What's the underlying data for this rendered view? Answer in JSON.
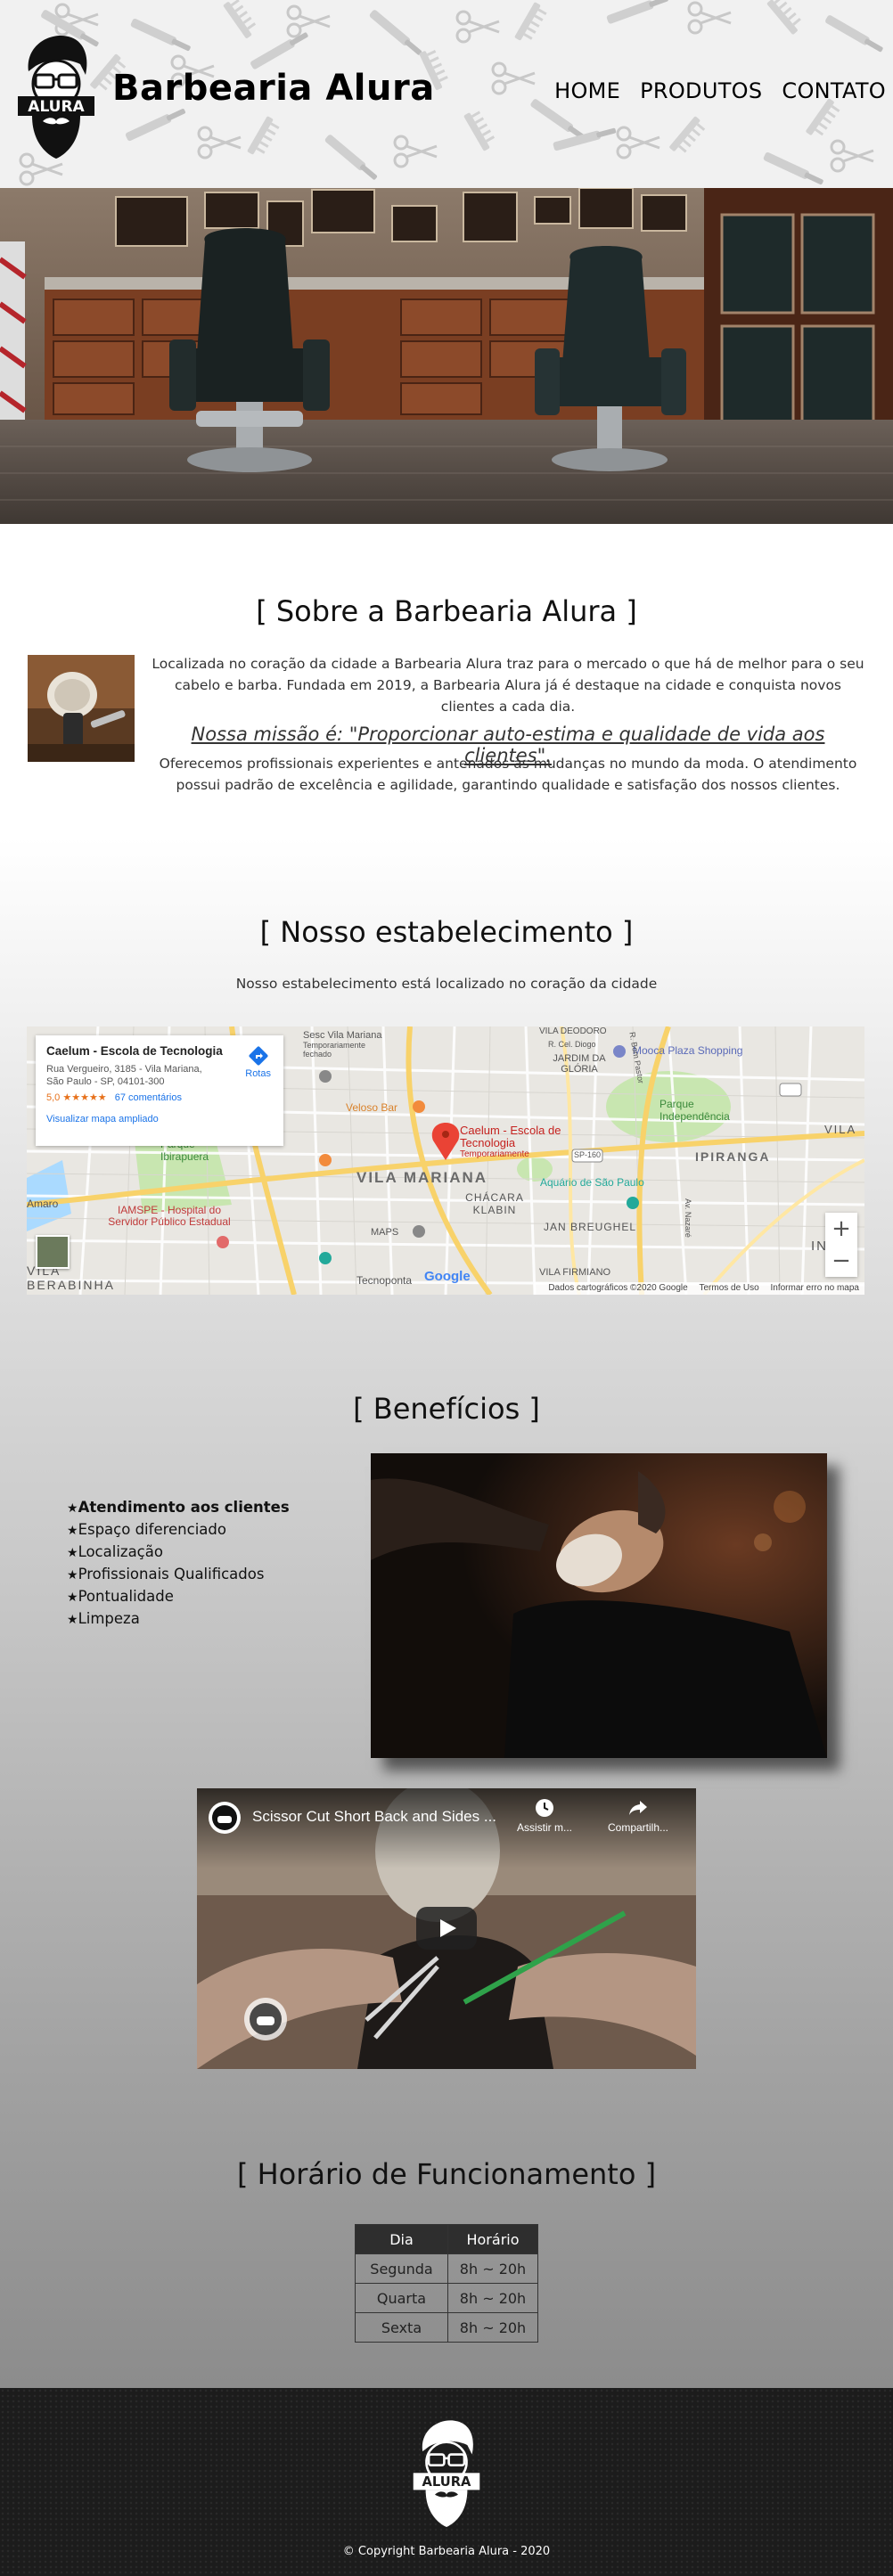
{
  "header": {
    "logo_text": "ALURA",
    "title": "Barbearia Alura",
    "nav": [
      "HOME",
      "PRODUTOS",
      "CONTATO"
    ]
  },
  "about": {
    "title": "[ Sobre a Barbearia Alura ]",
    "paragraph1": "Localizada no coração da cidade a Barbearia Alura traz para o mercado o que há de melhor para o seu cabelo e barba. Fundada em 2019, a Barbearia Alura já é destaque na cidade e conquista novos clientes a cada dia.",
    "mission": "Nossa missão é: \"Proporcionar auto-estima e qualidade de vida aos clientes\".",
    "paragraph2": "Oferecemos profissionais experientes e antenados às mudanças no mundo da moda. O atendimento possui padrão de excelência e agilidade, garantindo qualidade e satisfação dos nossos clientes."
  },
  "establishment": {
    "title": "[ Nosso estabelecimento ]",
    "subtitle": "Nosso estabelecimento está localizado no coração da cidade",
    "map": {
      "place_name": "Caelum - Escola de Tecnologia",
      "address": "Rua Vergueiro, 3185 - Vila Mariana, São Paulo - SP, 04101-300",
      "rating": "5,0",
      "stars": "★★★★★",
      "reviews": "67 comentários",
      "larger_map": "Visualizar mapa ampliado",
      "routes": "Rotas",
      "pin_label": "Caelum - Escola de Tecnologia",
      "pin_status": "Temporariamente",
      "zoom_in": "+",
      "zoom_out": "−",
      "google": "Google",
      "footer_data": "Dados cartográficos ©2020 Google",
      "footer_terms": "Termos de Uso",
      "footer_report": "Informar erro no mapa",
      "labels": {
        "vila_mariana": "VILA MARIANA",
        "ipiranga": "IPIRANGA",
        "jardim_gloria": "JARDIM DA GLÓRIA",
        "chacara_klabin": "CHÁCARA KLABIN",
        "jan_breughel": "JAN BREUGHEL",
        "vila_firmiano": "VILA FIRMIANO",
        "parque_independencia": "Parque Independência",
        "parque_ibirapuera": "Parque Ibirapuera",
        "aquario": "Aquário de São Paulo",
        "mooca": "Mooca Plaza Shopping",
        "veloso": "Veloso Bar",
        "iamspe": "IAMSPE - Hospital do Servidor Público Estadual",
        "maps": "MAPS",
        "tecnoponta": "Tecnoponta",
        "sesc": "Sesc Vila Mariana",
        "vila_deodoro": "VILA DEODORO",
        "sp160": "SP-160",
        "vila_right": "VILA",
        "ind": "IND",
        "vila_bottom": "VILA",
        "berabinha": "BERABINHA",
        "amaro": "Amaro",
        "temp_closed": "Temporariamente fechado",
        "cel_diogo": "R. Cel. Diogo",
        "av_nazare": "Av. Nazaré",
        "r_bom_pastor": "R. Bom Pastor"
      }
    }
  },
  "benefits": {
    "title": "[ Benefícios ]",
    "items": [
      "Atendimento aos clientes",
      "Espaço diferenciado",
      "Localização",
      "Profissionais Qualificados",
      "Pontualidade",
      "Limpeza"
    ]
  },
  "video": {
    "title": "Scissor Cut Short Back and Sides ...",
    "watch_later": "Assistir m...",
    "share": "Compartilh..."
  },
  "hours": {
    "title": "[ Horário de Funcionamento ]",
    "headers": [
      "Dia",
      "Horário"
    ],
    "rows": [
      [
        "Segunda",
        "8h ~ 20h"
      ],
      [
        "Quarta",
        "8h ~ 20h"
      ],
      [
        "Sexta",
        "8h ~ 20h"
      ]
    ]
  },
  "footer": {
    "logo_text": "ALURA",
    "copyright": "© Copyright Barbearia Alura - 2020"
  }
}
